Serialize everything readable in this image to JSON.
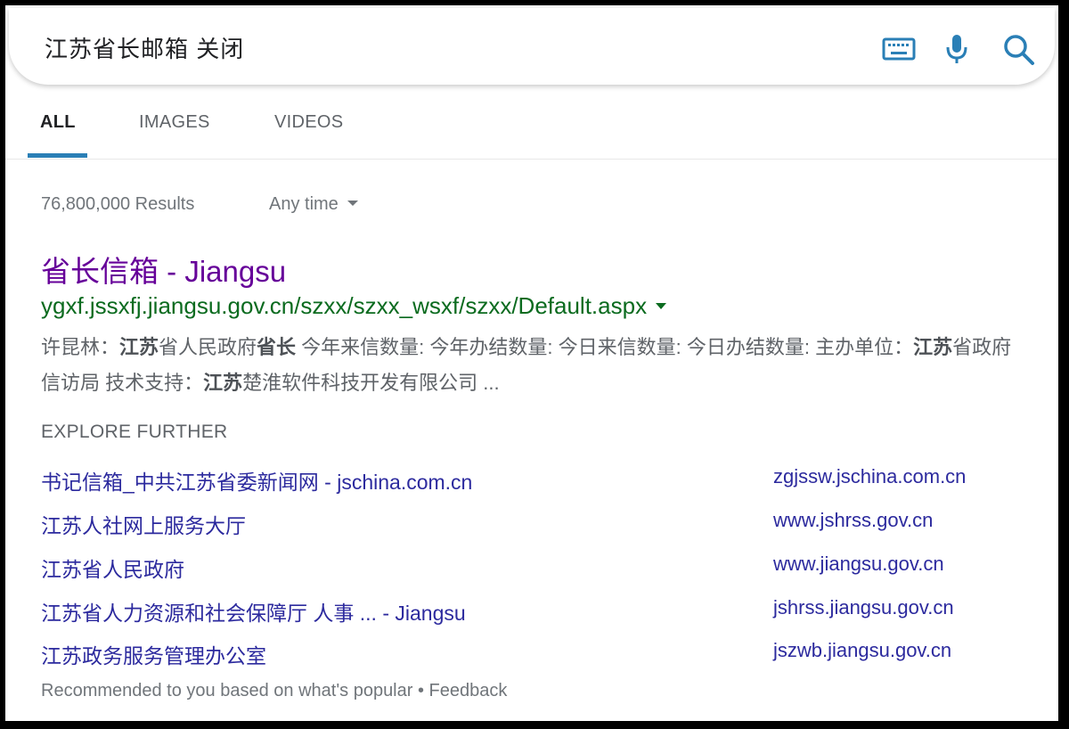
{
  "search": {
    "query": "江苏省长邮箱 关闭"
  },
  "icons": {
    "keyboard": "keyboard-icon",
    "mic": "microphone-icon",
    "search": "search-icon"
  },
  "colors": {
    "accent": "#2a7fb6",
    "visited_title": "#660099",
    "url_green": "#0b6b1f",
    "link_blue": "#2c2a9e"
  },
  "tabs": [
    {
      "label": "ALL",
      "active": true
    },
    {
      "label": "IMAGES",
      "active": false
    },
    {
      "label": "VIDEOS",
      "active": false
    }
  ],
  "results_info": {
    "count": "76,800,000 Results",
    "time_filter": "Any time"
  },
  "result": {
    "title": "省长信箱 - Jiangsu",
    "url": "ygxf.jssxfj.jiangsu.gov.cn/szxx/szxx_wsxf/szxx/Default.aspx",
    "snippet": [
      {
        "t": "许昆林：",
        "b": false
      },
      {
        "t": "江苏",
        "b": true
      },
      {
        "t": "省人民政府",
        "b": false
      },
      {
        "t": "省长",
        "b": true
      },
      {
        "t": " 今年来信数量: 今年办结数量: 今日来信数量: 今日办结数量: 主办单位：",
        "b": false
      },
      {
        "t": "江苏",
        "b": true
      },
      {
        "t": "省政府信访局 技术支持：",
        "b": false
      },
      {
        "t": "江苏",
        "b": true
      },
      {
        "t": "楚淮软件科技开发有限公司 ...",
        "b": false
      }
    ]
  },
  "explore": {
    "header": "EXPLORE FURTHER",
    "items": [
      {
        "title": "书记信箱_中共江苏省委新闻网 - jschina.com.cn",
        "domain": "zgjssw.jschina.com.cn"
      },
      {
        "title": "江苏人社网上服务大厅",
        "domain": "www.jshrss.gov.cn"
      },
      {
        "title": "江苏省人民政府",
        "domain": "www.jiangsu.gov.cn"
      },
      {
        "title": "江苏省人力资源和社会保障厅 人事 ... - Jiangsu",
        "domain": "jshrss.jiangsu.gov.cn"
      },
      {
        "title": "江苏政务服务管理办公室",
        "domain": "jszwb.jiangsu.gov.cn"
      }
    ]
  },
  "footer": {
    "note": "Recommended to you based on what's popular • Feedback"
  }
}
